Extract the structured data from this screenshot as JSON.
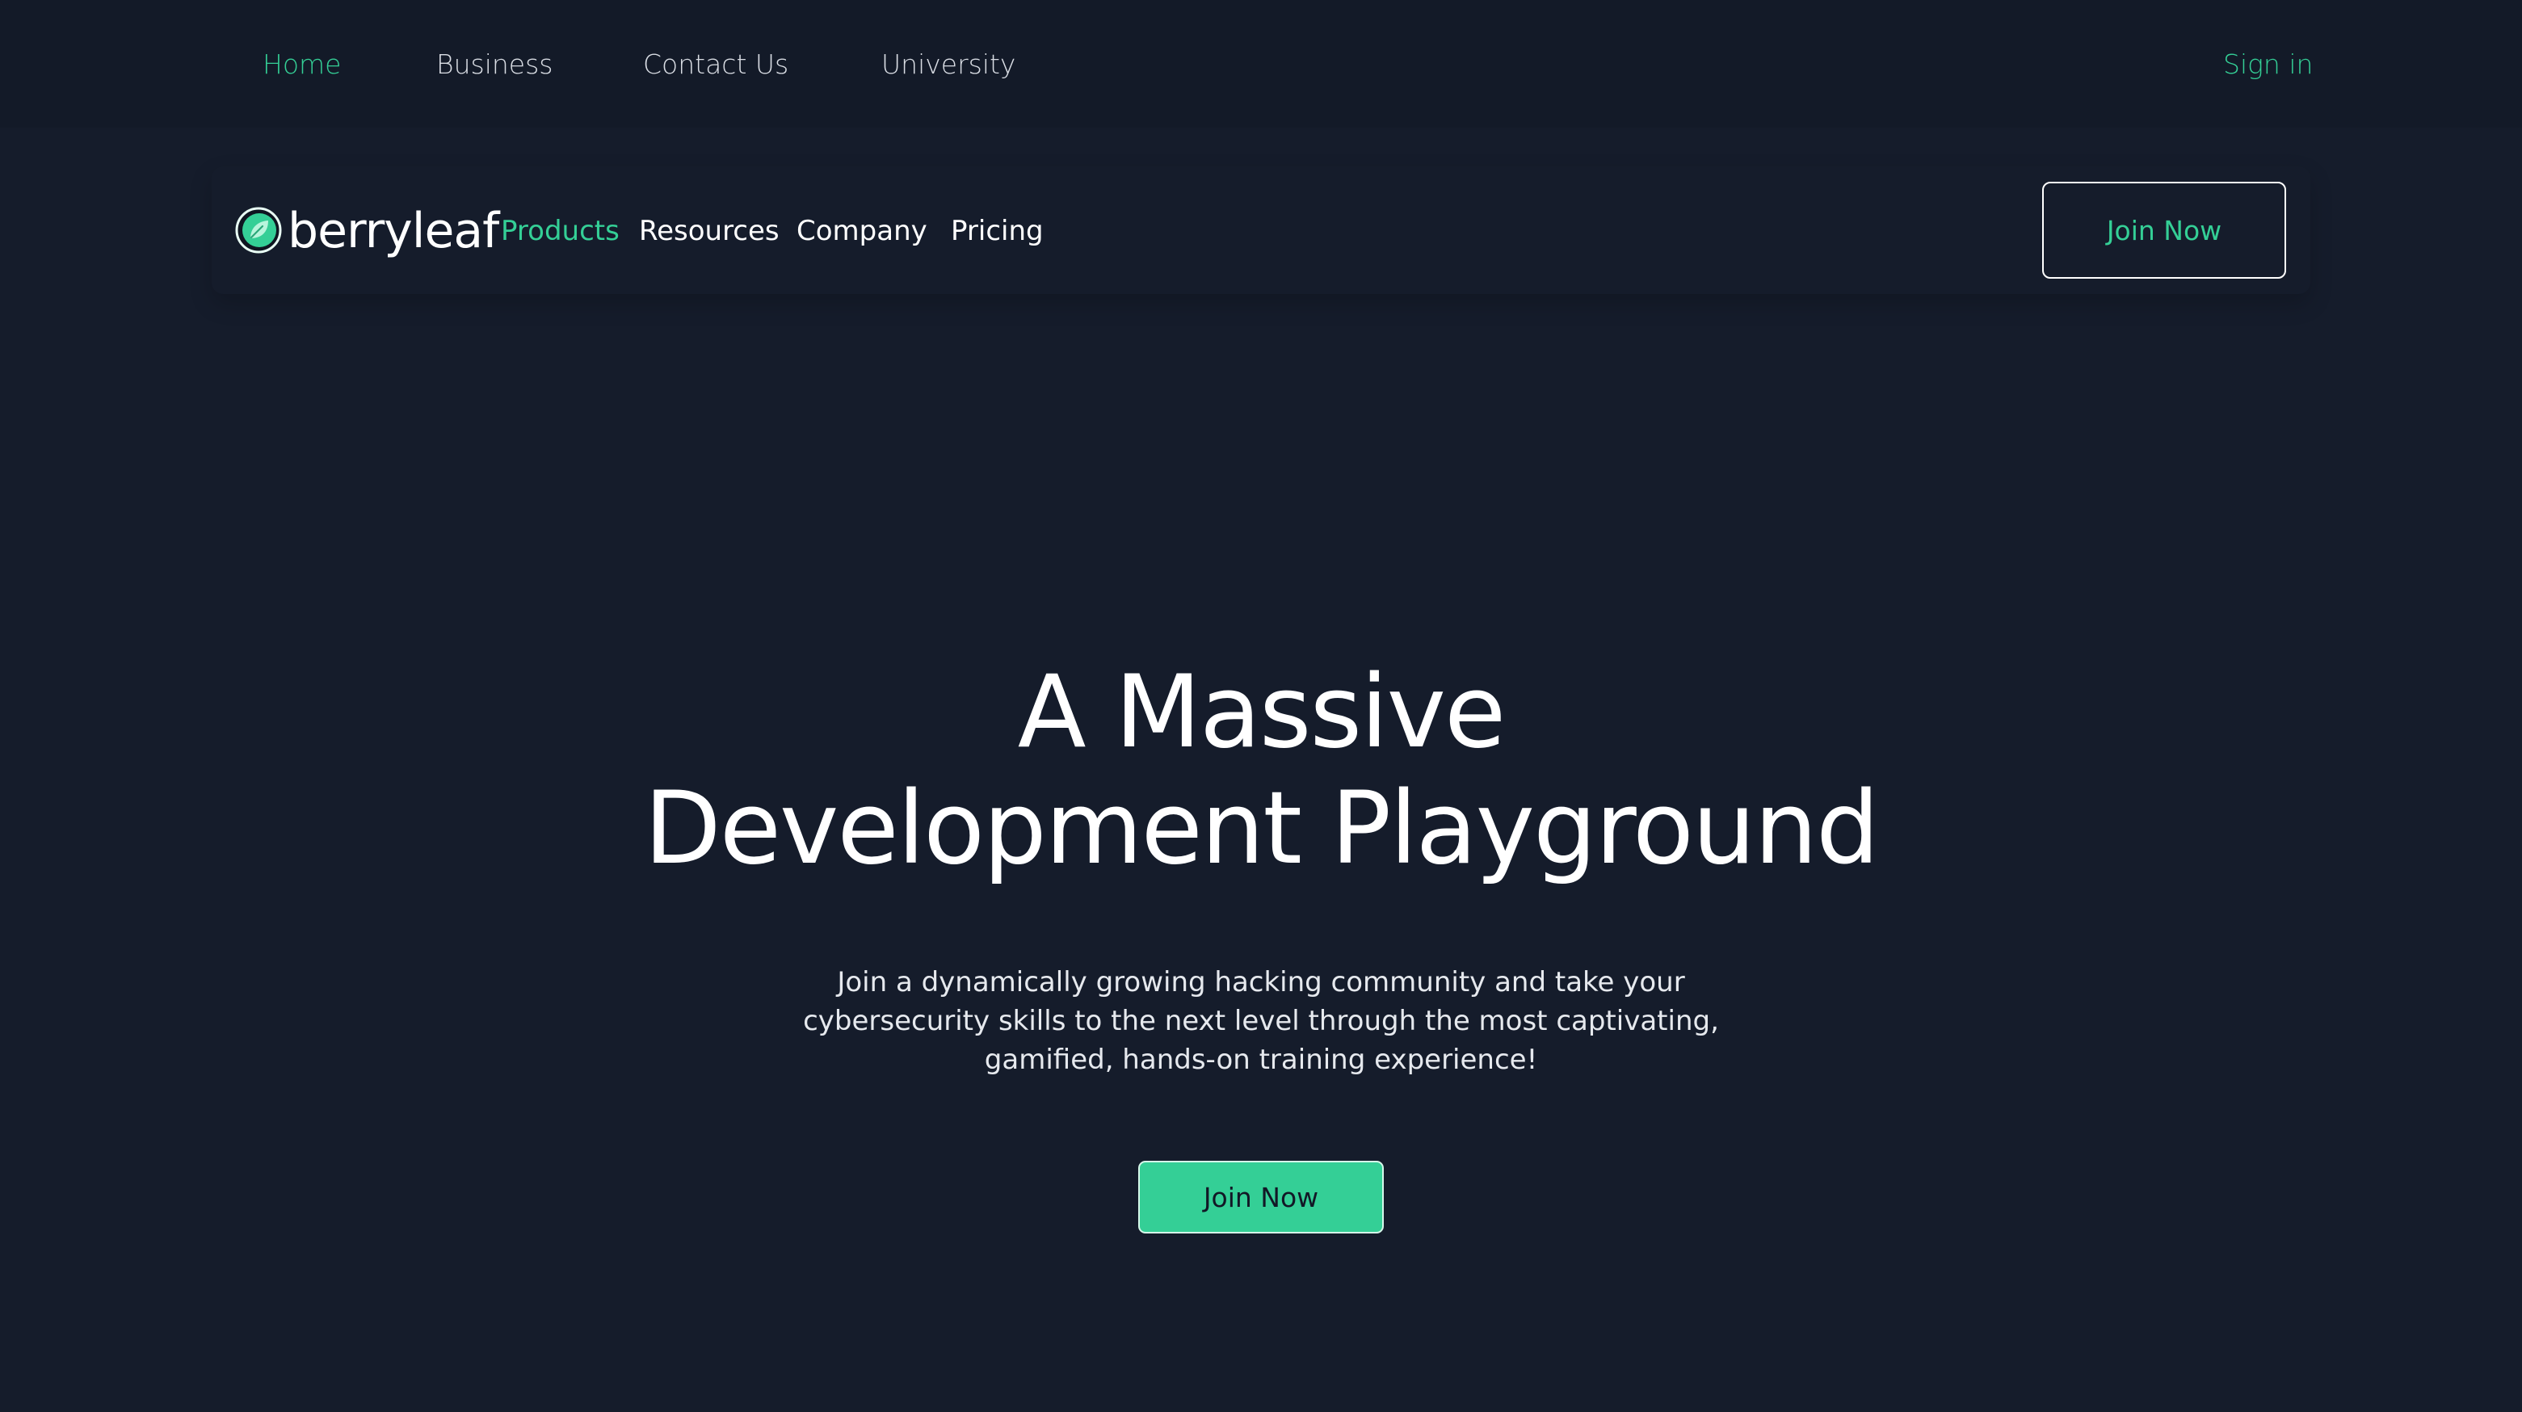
{
  "top_nav": {
    "items": [
      {
        "label": "Home",
        "active": true
      },
      {
        "label": "Business",
        "active": false
      },
      {
        "label": "Contact Us",
        "active": false
      },
      {
        "label": "University",
        "active": false
      }
    ],
    "sign_in": "Sign in"
  },
  "header": {
    "brand": "berryleaf",
    "logo_icon": "leaf-icon",
    "nav": [
      {
        "label": "Products",
        "active": true
      },
      {
        "label": "Resources",
        "active": false
      },
      {
        "label": "Company",
        "active": false
      },
      {
        "label": "Pricing",
        "active": false
      }
    ],
    "cta": "Join Now"
  },
  "hero": {
    "title_lines": [
      "A Massive",
      "Development Playground"
    ],
    "subtitle_lines": [
      "Join a dynamically growing hacking community and take your",
      "cybersecurity skills to the next level through the most captivating,",
      "gamified, hands-on training experience!"
    ],
    "cta": "Join Now"
  },
  "colors": {
    "background": "#151c2b",
    "top_bar": "#131a28",
    "accent": "#34cf96",
    "text": "#ffffff"
  }
}
